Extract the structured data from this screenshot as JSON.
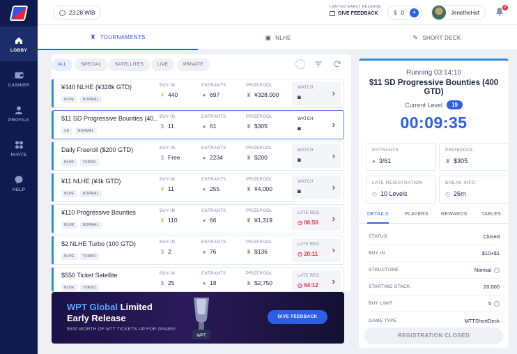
{
  "sidebar": {
    "items": [
      {
        "label": "LOBBY",
        "icon": "home-icon",
        "active": true
      },
      {
        "label": "CASHIER",
        "icon": "wallet-icon",
        "active": false
      },
      {
        "label": "PROFILE",
        "icon": "user-icon",
        "active": false
      },
      {
        "label": "INVITE",
        "icon": "invite-icon",
        "active": false
      },
      {
        "label": "HELP",
        "icon": "chat-icon",
        "active": false
      }
    ]
  },
  "header": {
    "clock": "23:28 WIB",
    "feedback_caption": "LIMITED EARLY RELEASE",
    "feedback_label": "GIVE FEEDBACK",
    "balance": "0",
    "username": "JenetheHot",
    "notification_count": "8"
  },
  "game_tabs": [
    {
      "label": "TOURNAMENTS",
      "active": true
    },
    {
      "label": "NLHE",
      "active": false
    },
    {
      "label": "SHORT DECK",
      "active": false
    }
  ],
  "filters": [
    "ALL",
    "SPECIAL",
    "SATELLITES",
    "LIVE",
    "PRIVATE"
  ],
  "columns": {
    "buyin": "BUY-IN",
    "entrants": "ENTRANTS",
    "prizepool": "PRIZEPOOL"
  },
  "tournaments": [
    {
      "name": "¥440 NLHE (¥328k GTD)",
      "tags": [
        "NLHE",
        "NORMAL"
      ],
      "buyin": "440",
      "entrants": "697",
      "prizepool": "¥328,000",
      "action": "WATCH",
      "action_value": "",
      "currency": "yen",
      "selected": false
    },
    {
      "name": "$11 SD Progressive Bounties (40...",
      "tags": [
        "SD",
        "NORMAL"
      ],
      "buyin": "11",
      "entrants": "61",
      "prizepool": "$305",
      "action": "WATCH",
      "action_value": "",
      "currency": "dollar",
      "selected": true
    },
    {
      "name": "Daily Freeroll ($200 GTD)",
      "tags": [
        "NLHE",
        "TURBO"
      ],
      "buyin": "Free",
      "entrants": "2234",
      "prizepool": "$200",
      "action": "WATCH",
      "action_value": "",
      "currency": "dollar",
      "selected": false
    },
    {
      "name": "¥11 NLHE (¥4k GTD)",
      "tags": [
        "NLHE",
        "NORMAL"
      ],
      "buyin": "11",
      "entrants": "255",
      "prizepool": "¥4,000",
      "action": "WATCH",
      "action_value": "",
      "currency": "yen",
      "selected": false
    },
    {
      "name": "¥110 Progressive Bounties",
      "tags": [
        "NLHE",
        "NORMAL"
      ],
      "buyin": "110",
      "entrants": "66",
      "prizepool": "¥1,319",
      "action": "LATE REG",
      "action_value": "06:50",
      "currency": "yen",
      "selected": false
    },
    {
      "name": "$2 NLHE Turbo (100 GTD)",
      "tags": [
        "NLHE",
        "TURBO"
      ],
      "buyin": "2",
      "entrants": "76",
      "prizepool": "$136",
      "action": "LATE REG",
      "action_value": "20:11",
      "currency": "dollar",
      "selected": false
    },
    {
      "name": "$550 Ticket Satellite",
      "tags": [
        "NLHE",
        "TURBO"
      ],
      "buyin": "25",
      "entrants": "18",
      "prizepool": "$2,750",
      "action": "LATE REG",
      "action_value": "64:12",
      "currency": "dollar",
      "selected": false
    }
  ],
  "banner": {
    "title_brand": "WPT Global",
    "title_rest": " Limited",
    "title_line2": "Early Release",
    "subtitle": "$500 WORTH OF MTT TICKETS UP FOR GRABS!",
    "button": "GIVE FEEDBACK",
    "trophy_text": "WPT"
  },
  "detail": {
    "status_line": "Running  03:14:10",
    "title": "$11 SD Progressive Bounties (400 GTD)",
    "level_label": "Current Level",
    "level": "19",
    "timer": "00:09:35",
    "boxes": [
      {
        "label": "ENTRANTS",
        "value": "3/61",
        "icon": "user-icon"
      },
      {
        "label": "PRIZEPOOL",
        "value": "$305",
        "icon": "trophy-icon"
      },
      {
        "label": "LATE REGISTRATION",
        "value": "10 Levels",
        "icon": "clock-icon"
      },
      {
        "label": "BREAK INFO",
        "value": "26m",
        "icon": "clock-icon"
      }
    ],
    "tabs": [
      "DETAILS",
      "PLAYERS",
      "REWARDS",
      "TABLES"
    ],
    "rows": [
      {
        "key": "STATUS",
        "value": "Closed",
        "info": false
      },
      {
        "key": "BUY IN",
        "value": "$10+$1",
        "info": false
      },
      {
        "key": "STRUCTURE",
        "value": "Normal",
        "info": true
      },
      {
        "key": "STARTING STACK",
        "value": "20,000",
        "info": false
      },
      {
        "key": "BUY LIMIT",
        "value": "5",
        "info": true
      },
      {
        "key": "GAME TYPE",
        "value": "MTTShortDeck",
        "info": false
      }
    ],
    "button": "REGISTRATION CLOSED"
  },
  "colors": {
    "accent": "#2c5ee8",
    "sidebar": "#0f1b4f",
    "danger": "#e23045",
    "gold": "#e2a21c"
  }
}
